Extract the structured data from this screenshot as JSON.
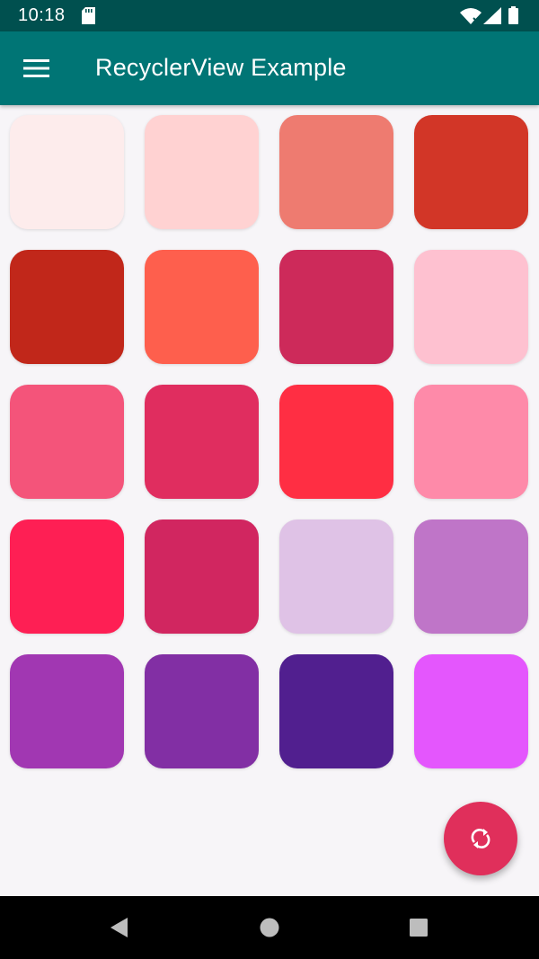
{
  "status_bar": {
    "time": "10:18",
    "background": "#00504f",
    "icons": [
      "sd-card-icon",
      "wifi-icon",
      "cell-signal-icon",
      "battery-icon"
    ]
  },
  "app_bar": {
    "title": "RecyclerView Example",
    "background": "#007575",
    "menu_icon": "hamburger-menu-icon"
  },
  "grid": {
    "columns": 4,
    "tiles": [
      "#fdecec",
      "#ffd2d2",
      "#ee7b70",
      "#d23627",
      "#c1271a",
      "#fe5f4d",
      "#cd2a5a",
      "#fec1d0",
      "#f4547a",
      "#e02d5f",
      "#ff2e43",
      "#fe8aa9",
      "#fe1f54",
      "#d12660",
      "#dfc2e6",
      "#bf75c8",
      "#a137b2",
      "#822fa4",
      "#511f8f",
      "#e456fd"
    ]
  },
  "fab": {
    "icon": "refresh-icon",
    "background": "#e02f5b"
  },
  "nav_bar": {
    "icons": [
      "back-triangle-icon",
      "home-circle-icon",
      "recents-square-icon"
    ]
  }
}
